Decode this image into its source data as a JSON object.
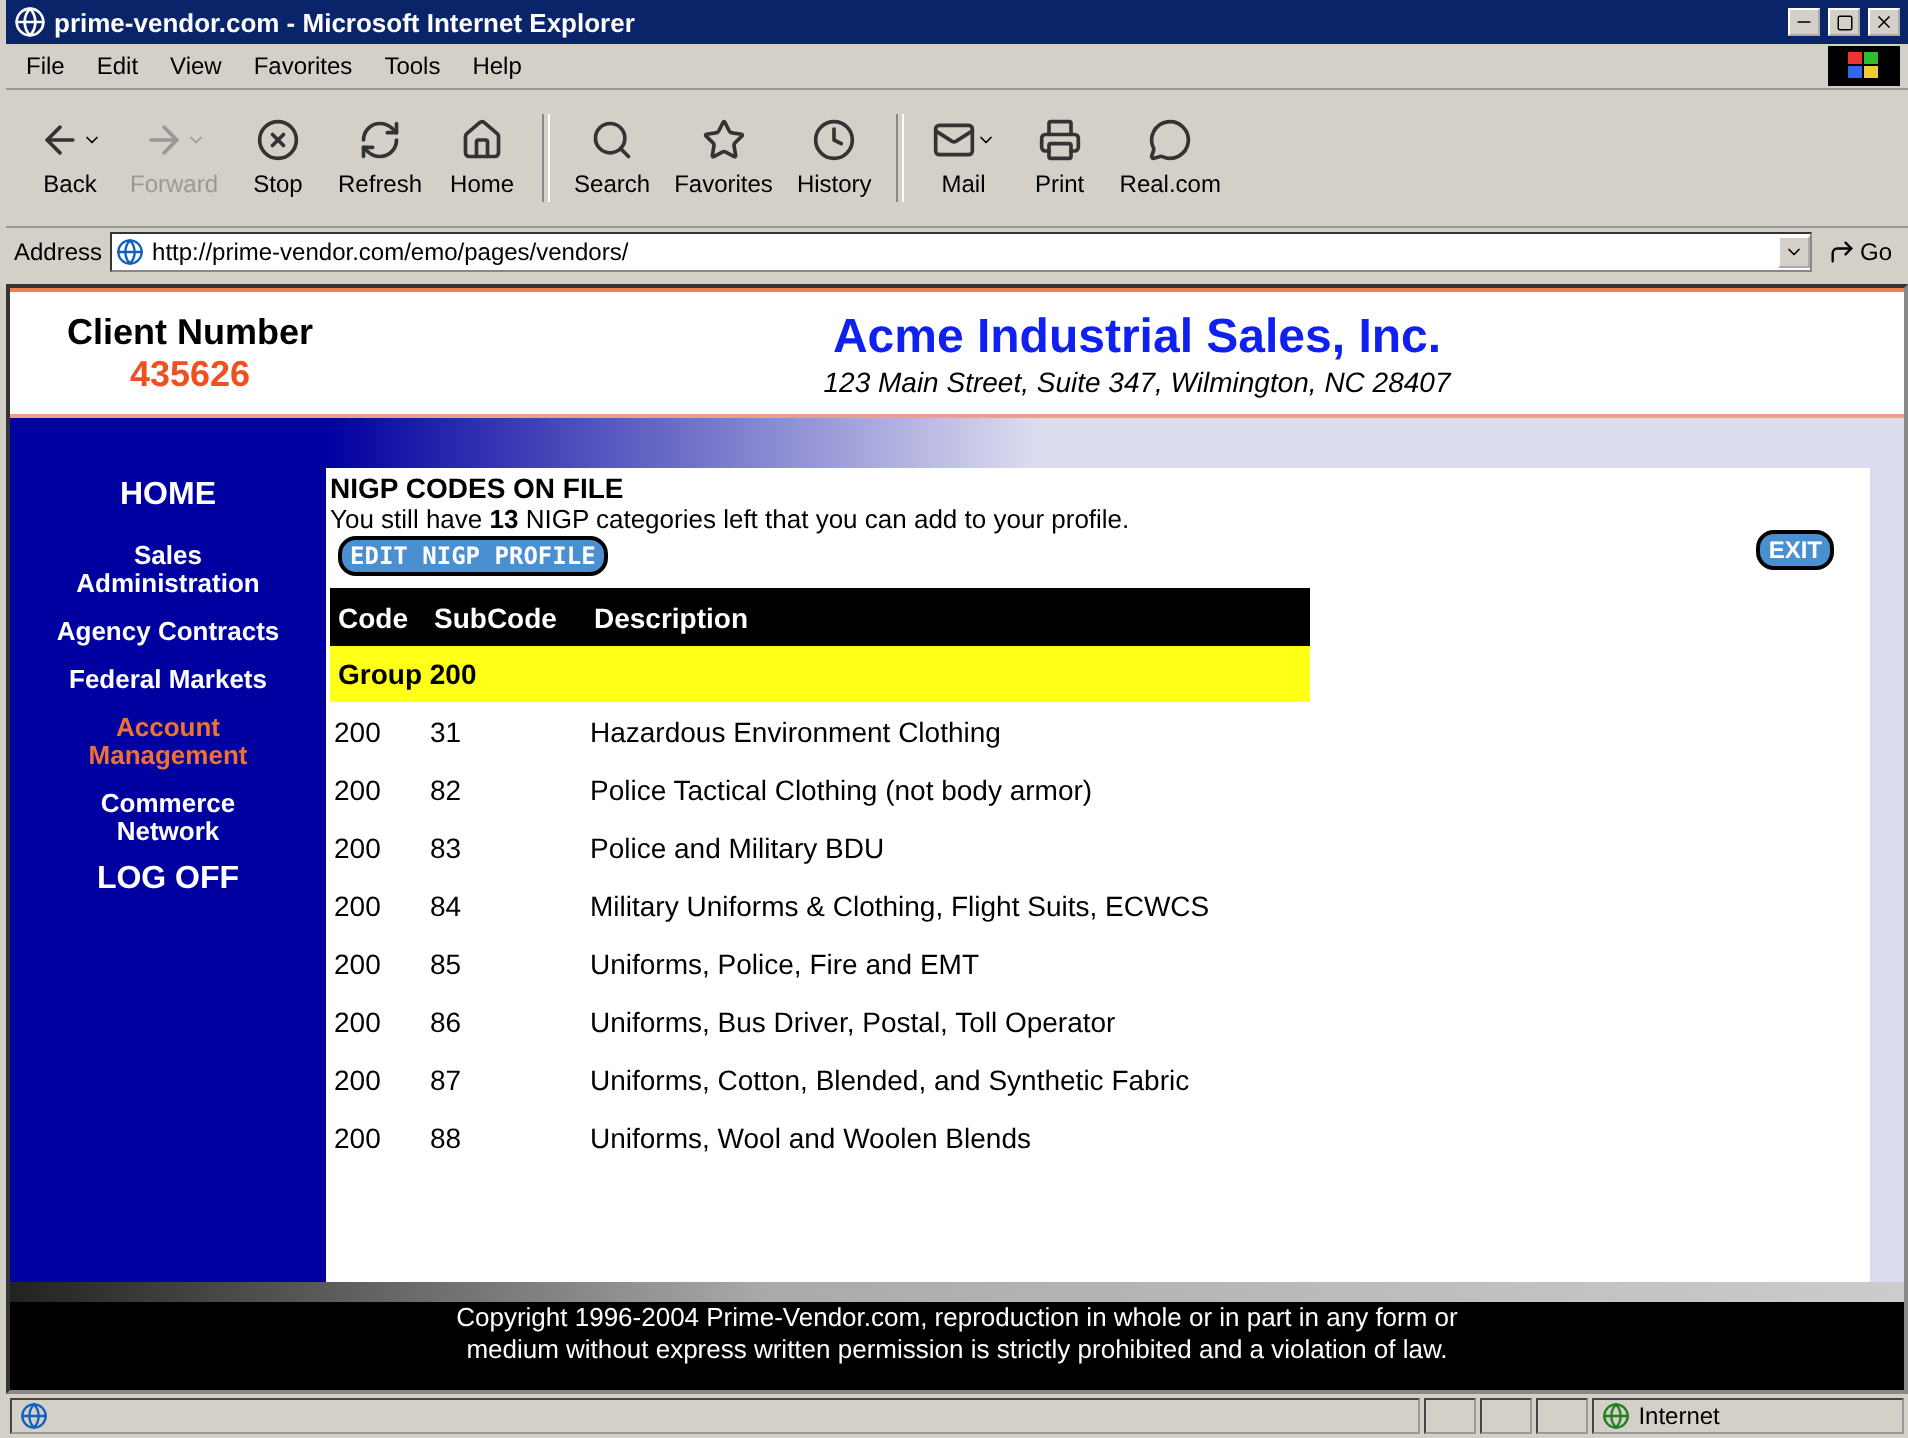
{
  "window": {
    "title": "prime-vendor.com - Microsoft Internet Explorer"
  },
  "menu": [
    "File",
    "Edit",
    "View",
    "Favorites",
    "Tools",
    "Help"
  ],
  "toolbar": [
    {
      "label": "Back",
      "kind": "back",
      "disabled": false,
      "dropdown": true
    },
    {
      "label": "Forward",
      "kind": "forward",
      "disabled": true,
      "dropdown": true
    },
    {
      "label": "Stop",
      "kind": "stop",
      "disabled": false,
      "dropdown": false
    },
    {
      "label": "Refresh",
      "kind": "refresh",
      "disabled": false,
      "dropdown": false
    },
    {
      "label": "Home",
      "kind": "home",
      "disabled": false,
      "dropdown": false
    },
    {
      "label": "Search",
      "kind": "search",
      "disabled": false,
      "dropdown": false
    },
    {
      "label": "Favorites",
      "kind": "favorites",
      "disabled": false,
      "dropdown": false
    },
    {
      "label": "History",
      "kind": "history",
      "disabled": false,
      "dropdown": false
    },
    {
      "label": "Mail",
      "kind": "mail",
      "disabled": false,
      "dropdown": true
    },
    {
      "label": "Print",
      "kind": "print",
      "disabled": false,
      "dropdown": false
    },
    {
      "label": "Real.com",
      "kind": "real",
      "disabled": false,
      "dropdown": false
    }
  ],
  "address": {
    "label": "Address",
    "value": "http://prime-vendor.com/emo/pages/vendors/",
    "go": "Go"
  },
  "header": {
    "client_label": "Client Number",
    "client_number": "435626",
    "company": "Acme Industrial Sales, Inc.",
    "company_address": "123 Main Street, Suite 347, Wilmington, NC 28407"
  },
  "nav": [
    {
      "label": "HOME",
      "kind": "big",
      "selected": false
    },
    {
      "label": "Sales Administration",
      "kind": "small",
      "selected": false
    },
    {
      "label": "Agency Contracts",
      "kind": "small",
      "selected": false
    },
    {
      "label": "Federal Markets",
      "kind": "small",
      "selected": false
    },
    {
      "label": "Account Management",
      "kind": "small",
      "selected": true
    },
    {
      "label": "Commerce Network",
      "kind": "small",
      "selected": false
    },
    {
      "label": "LOG OFF",
      "kind": "big",
      "selected": false
    }
  ],
  "panel": {
    "title": "NIGP CODES ON FILE",
    "note": "You still have **13** NIGP categories left that you can add to your profile.",
    "edit_button": "EDIT NIGP PROFILE",
    "exit_button": "EXIT"
  },
  "table": {
    "columns": [
      "Code",
      "SubCode",
      "Description"
    ],
    "group": "Group 200",
    "rows": [
      [
        "200",
        "31",
        "Hazardous Environment Clothing"
      ],
      [
        "200",
        "82",
        "Police Tactical Clothing (not body armor)"
      ],
      [
        "200",
        "83",
        "Police and Military BDU"
      ],
      [
        "200",
        "84",
        "Military Uniforms & Clothing, Flight Suits, ECWCS"
      ],
      [
        "200",
        "85",
        "Uniforms, Police, Fire and EMT"
      ],
      [
        "200",
        "86",
        "Uniforms, Bus Driver, Postal, Toll Operator"
      ],
      [
        "200",
        "87",
        "Uniforms, Cotton, Blended, and Synthetic Fabric"
      ],
      [
        "200",
        "88",
        "Uniforms, Wool and Woolen Blends"
      ]
    ]
  },
  "footer": [
    "Copyright 1996-2004 Prime-Vendor.com, reproduction in whole or in part in any form or",
    "medium without express written permission is strictly prohibited and a violation of law."
  ],
  "status_bar": {
    "zone": "Internet"
  }
}
